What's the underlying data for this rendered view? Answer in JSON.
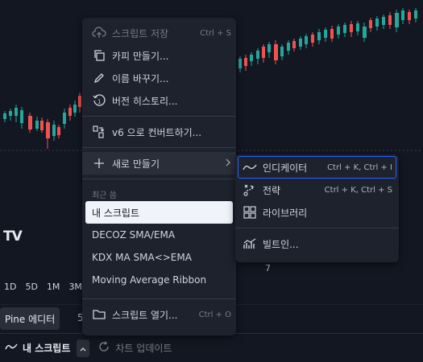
{
  "chart": {
    "timeframes": [
      "1D",
      "5D",
      "1M",
      "3M"
    ],
    "label_right": "7"
  },
  "tabs": {
    "pine_editor": "Pine 에디터",
    "partial_tab": "5"
  },
  "bottombar": {
    "script_name": "내 스크립트",
    "update_label": "차트 업데이트"
  },
  "menu": {
    "save": {
      "label": "스크립트 저장",
      "shortcut": "Ctrl + S",
      "icon": "cloud-upload-icon"
    },
    "copy": {
      "label": "카피 만들기...",
      "icon": "copy-icon"
    },
    "rename": {
      "label": "이름 바꾸기...",
      "icon": "pencil-icon"
    },
    "history": {
      "label": "버전 히스토리...",
      "icon": "history-icon"
    },
    "convert": {
      "label": "v6 으로 컨버트하기...",
      "icon": "convert-icon"
    },
    "create_new": {
      "label": "새로 만들기",
      "icon": "plus-icon"
    },
    "recent_header": "최근 씀",
    "recent": [
      "내 스크립트",
      "DECOZ SMA/EMA",
      "KDX MA SMA<>EMA",
      "Moving Average Ribbon"
    ],
    "open": {
      "label": "스크립트 열기...",
      "shortcut": "Ctrl + O",
      "icon": "folder-icon"
    }
  },
  "submenu": {
    "indicator": {
      "label": "인디케이터",
      "shortcut": "Ctrl + K, Ctrl + I",
      "icon": "indicator-wave-icon"
    },
    "strategy": {
      "label": "전략",
      "shortcut": "Ctrl + K, Ctrl + S",
      "icon": "strategy-icon"
    },
    "library": {
      "label": "라이브러리",
      "icon": "library-icon"
    },
    "builtin": {
      "label": "빌트인...",
      "icon": "builtin-chart-icon"
    }
  },
  "colors": {
    "background": "#131722",
    "menu_bg": "#1e222d",
    "candle_up": "#26a69a",
    "candle_down": "#ef5350",
    "accent": "#2962ff"
  }
}
